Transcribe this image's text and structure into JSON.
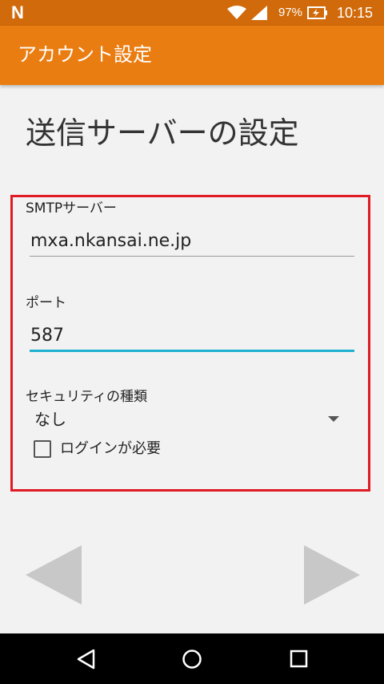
{
  "status_bar": {
    "notification_icon": "N",
    "battery_percent": "97%",
    "time": "10:15",
    "icons": [
      "wifi-icon",
      "signal-icon",
      "battery-charging-icon"
    ]
  },
  "app_bar": {
    "title": "アカウント設定",
    "color": "#ea7d12"
  },
  "page": {
    "heading": "送信サーバーの設定"
  },
  "form": {
    "smtp_server": {
      "label": "SMTPサーバー",
      "value": "mxa.nkansai.ne.jp"
    },
    "port": {
      "label": "ポート",
      "value": "587"
    },
    "security_type": {
      "label": "セキュリティの種類",
      "selected": "なし"
    },
    "require_login": {
      "label": "ログインが必要",
      "checked": false
    }
  },
  "colors": {
    "accent": "#1fb2d0",
    "highlight_border": "#e01b24",
    "status_bar": "#d06a0a"
  },
  "navigation": {
    "prev_icon": "left-triangle-icon",
    "next_icon": "right-triangle-icon",
    "system_icons": [
      "back-icon",
      "home-icon",
      "recents-icon"
    ]
  }
}
